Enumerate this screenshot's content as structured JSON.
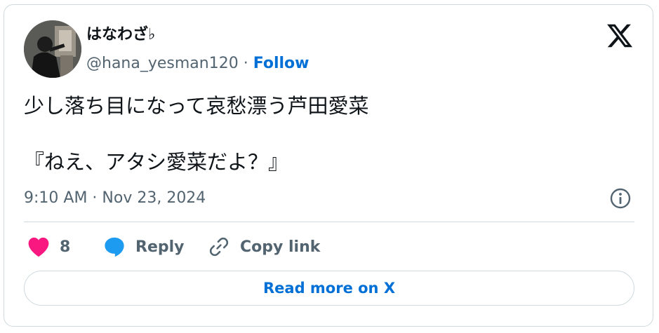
{
  "author": {
    "display_name": "はなわざ♭",
    "handle": "@hana_yesman120",
    "separator": "·",
    "follow_label": "Follow"
  },
  "tweet": {
    "lines": [
      "少し落ち目になって哀愁漂う芦田愛菜",
      "『ねえ、アタシ愛菜だよ？』"
    ],
    "timestamp": "9:10 AM · Nov 23, 2024"
  },
  "actions": {
    "like_count": "8",
    "reply_label": "Reply",
    "copy_link_label": "Copy link"
  },
  "read_more_label": "Read more on X",
  "icons": {
    "brand": "x-logo-icon",
    "info": "info-icon",
    "like": "heart-icon",
    "reply": "speech-bubble-icon",
    "copy": "link-icon"
  },
  "colors": {
    "like": "#f91880",
    "reply": "#1d9bf0",
    "link_blue": "#006fd6",
    "muted_text": "#536471",
    "border": "#cfd9de",
    "text": "#0f1419"
  }
}
